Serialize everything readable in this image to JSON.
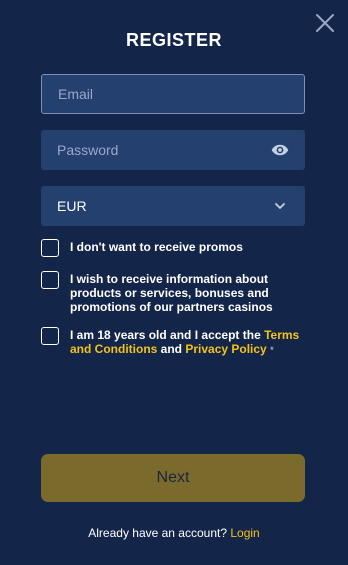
{
  "header": {
    "title": "REGISTER",
    "close_icon": "close-icon"
  },
  "form": {
    "email": {
      "value": "",
      "placeholder": "Email"
    },
    "password": {
      "value": "",
      "placeholder": "Password",
      "icon": "eye-icon"
    },
    "currency": {
      "selected": "EUR",
      "icon": "chevron-down-icon"
    }
  },
  "checkboxes": {
    "no_promos": {
      "label": "I don't want to receive promos",
      "checked": false
    },
    "partners_info": {
      "label": "I wish to receive information about products or services, bonuses and promotions of our partners casinos",
      "checked": false
    },
    "terms": {
      "prefix": "I am 18 years old and I accept the ",
      "terms_link": "Terms and Conditions",
      "middle": " and ",
      "privacy_link": "Privacy Policy",
      "required_mark": "*",
      "checked": false
    }
  },
  "actions": {
    "next_label": "Next"
  },
  "footer": {
    "text": "Already have an account?",
    "login_link": "Login"
  },
  "colors": {
    "background": "#14254a",
    "field_background": "#24406f",
    "accent_yellow": "#f2c21a",
    "next_button": "#7a6a2c"
  }
}
